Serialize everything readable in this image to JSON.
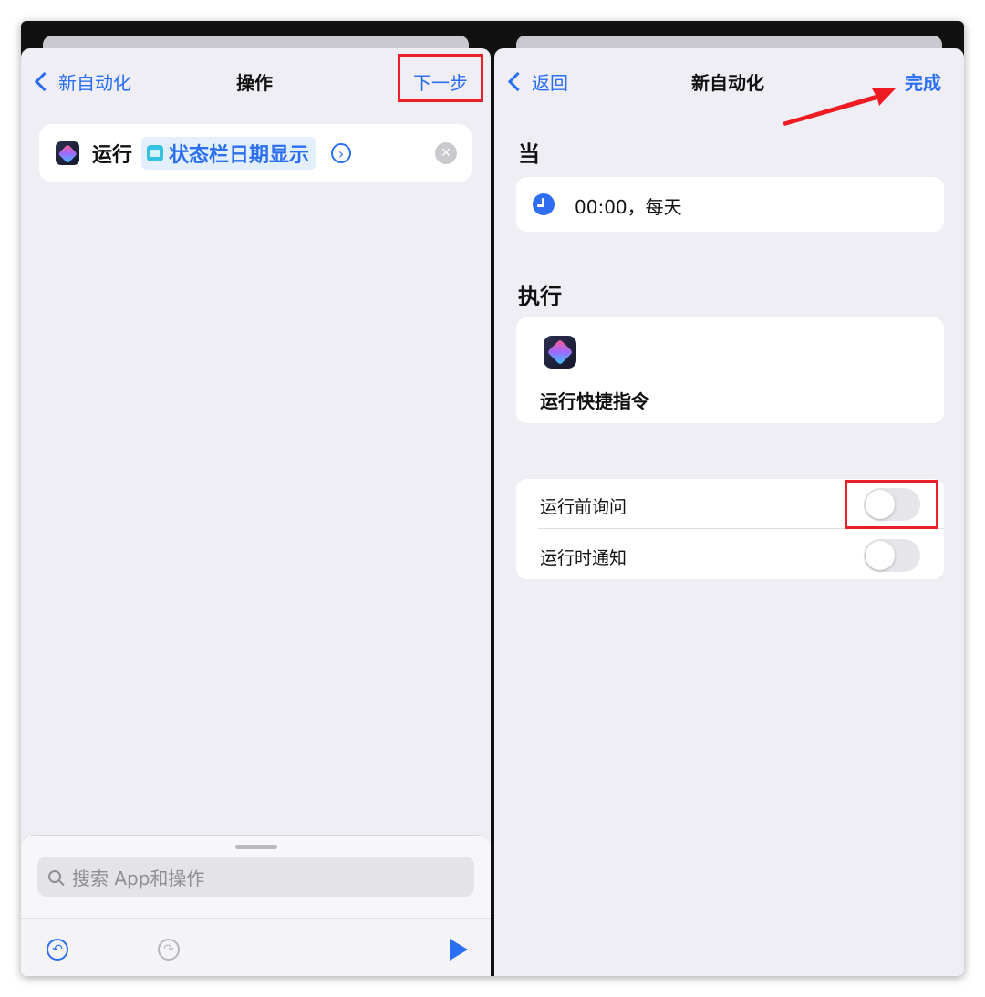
{
  "left": {
    "back_label": "新自动化",
    "title": "操作",
    "next_label": "下一步",
    "action": {
      "verb": "运行",
      "shortcut_name": "状态栏日期显示",
      "detail_arrow": "›",
      "clear_glyph": "✕"
    },
    "search": {
      "placeholder": "搜索 App和操作"
    },
    "toolbar": {
      "undo_glyph": "↶",
      "redo_glyph": "↷"
    }
  },
  "right": {
    "back_label": "返回",
    "title": "新自动化",
    "done_label": "完成",
    "when_title": "当",
    "trigger_text": "00:00，每天",
    "do_title": "执行",
    "do_action_label": "运行快捷指令",
    "settings": [
      {
        "label": "运行前询问",
        "on": false
      },
      {
        "label": "运行时通知",
        "on": false
      }
    ]
  },
  "colors": {
    "accent": "#2a6ef4",
    "highlight": "#e8202a",
    "background": "#efeef4"
  },
  "icons": [
    "chevron-left-icon",
    "shortcuts-app-icon",
    "calendar-icon",
    "chevron-right-circle-icon",
    "clear-icon",
    "search-icon",
    "undo-icon",
    "redo-icon",
    "play-icon",
    "clock-icon"
  ]
}
